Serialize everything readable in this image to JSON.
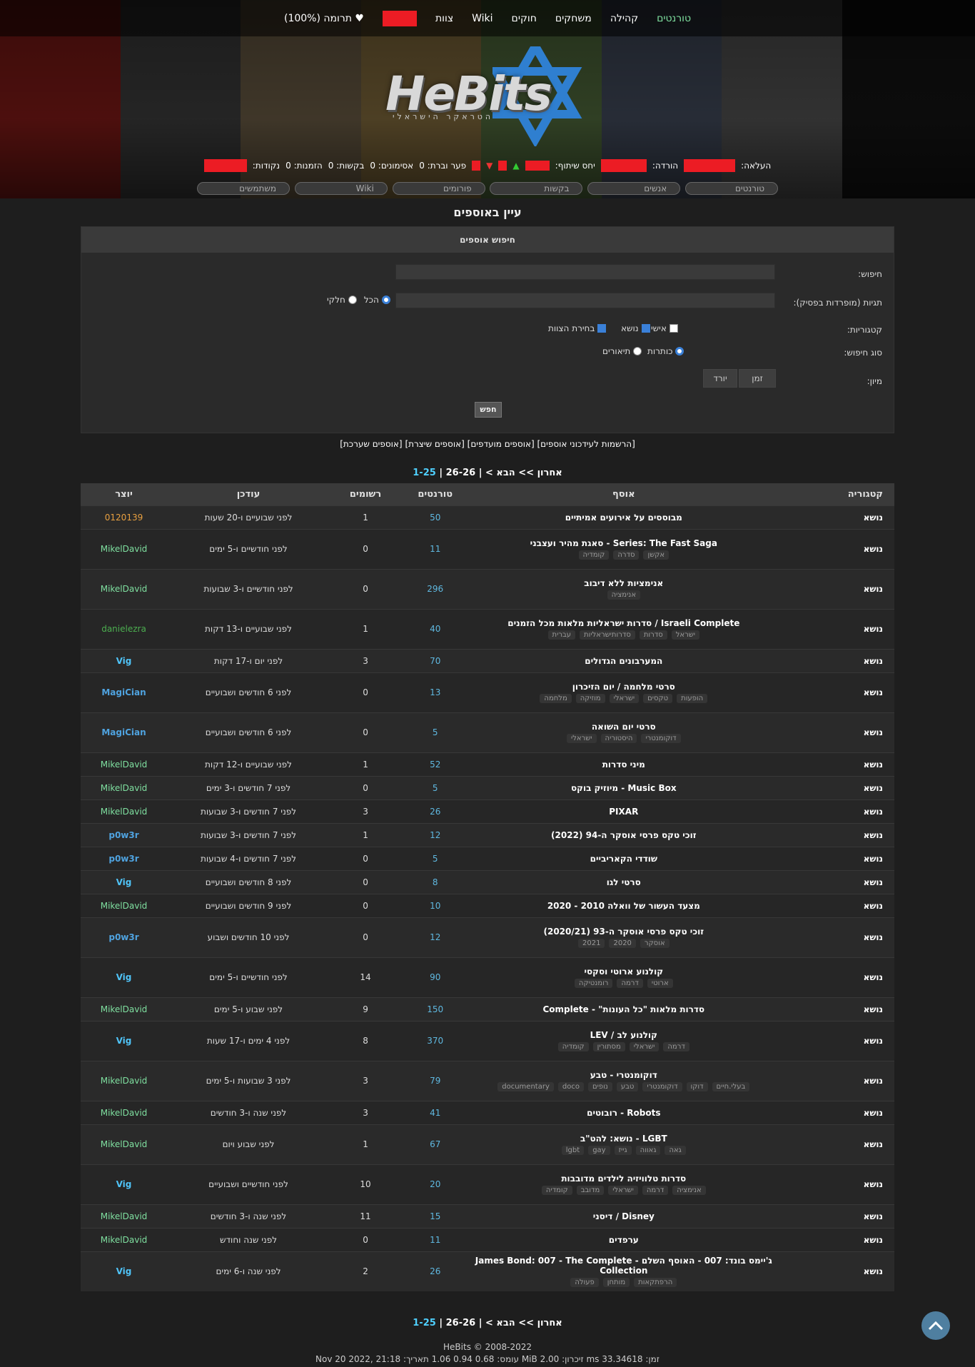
{
  "colors": {
    "accent": "#4fd0ff",
    "active_link": "#7fe0a0",
    "redaction": "#ec1c24"
  },
  "topnav": {
    "items": [
      "טורנטים",
      "קהילה",
      "משחקים",
      "חוקים",
      "Wiki",
      "צוות"
    ],
    "donate": "תרומה (100%)"
  },
  "logo": {
    "text": "HeBits",
    "sub": "הטראקר הישראלי"
  },
  "stats": {
    "upload": "העלאה:",
    "download": "הורדה:",
    "ratio": "יחס שיתוף:",
    "membership": "פער וברת: 0",
    "bookmarks": "אסימונים: 0",
    "requests": "בקשות: 0",
    "invites": "הזמנות: 0",
    "points": "נקודות:"
  },
  "subnav": [
    "טורנטים",
    "אנשים",
    "בקשות",
    "פורומים",
    "Wiki",
    "משתמשים"
  ],
  "page_title": "עיין באוספים",
  "search_panel": {
    "header": "חיפוש אוספים",
    "search_label": "חיפוש:",
    "tags_label": "תגיות (מופרדות בפסיק):",
    "tags_partial": "חלקי",
    "tags_all": "הכל",
    "categories_label": "קטגוריות:",
    "cat_personal": "אישי",
    "cat_topic": "נושא",
    "cat_staff": "בחירת הצוות",
    "search_type_label": "סוג חיפוש:",
    "type_titles": "כותרות",
    "type_desc": "תיאורים",
    "sort_label": "מיון:",
    "sort_time": "זמן",
    "sort_desc": "יורד",
    "search_btn": "חפש"
  },
  "links": [
    "[הרשמות לעידכוני אוספים]",
    "[אוספים מועדפים]",
    "[אוספים שיצרת]",
    "[אוספים שערכת]"
  ],
  "pager": {
    "current": "1-25",
    "next_range": "26-26",
    "next": "הבא >",
    "last": "אחרון >>",
    "sep": " | "
  },
  "table": {
    "headers": [
      "קטגוריה",
      "אוסף",
      "טורנטים",
      "רשומים",
      "עודכן",
      "יוצר"
    ],
    "rows": [
      {
        "cat": "נושא",
        "name": "מבוססים על אירועים אמיתיים",
        "tags": [],
        "torrents": "50",
        "subs": "1",
        "updated": "לפני שבועיים ו-20 שעות",
        "user": "0120139",
        "ucolor": "#e8a040",
        "ubold": false
      },
      {
        "cat": "נושא",
        "name": "Series: The Fast Saga - סאגת מהיר ועצבני",
        "tags": [
          "אקשן",
          "סדרה",
          "קומדיה"
        ],
        "torrents": "11",
        "subs": "0",
        "updated": "לפני חודשיים ו-5 ימים",
        "user": "MikelDavid",
        "ucolor": "#7fe0a0",
        "ubold": false
      },
      {
        "cat": "נושא",
        "name": "אנימציות ללא דיבוב",
        "tags": [
          "אנימציה"
        ],
        "torrents": "296",
        "subs": "0",
        "updated": "לפני חודשיים ו-3 שבועות",
        "user": "MikelDavid",
        "ucolor": "#7fe0a0",
        "ubold": false
      },
      {
        "cat": "נושא",
        "name": "Israeli Complete / סדרות ישראליות מלאות מכל הזמנים",
        "tags": [
          "ישראל",
          "סדרות",
          "סדרותישראליות",
          "עברית"
        ],
        "torrents": "40",
        "subs": "1",
        "updated": "לפני שבועיים ו-13 דקות",
        "user": "danielezra",
        "ucolor": "#4caf50",
        "ubold": false
      },
      {
        "cat": "נושא",
        "name": "המערבונים הגדולים",
        "tags": [],
        "torrents": "70",
        "subs": "3",
        "updated": "לפני יום ו-17 דקות",
        "user": "Vig",
        "ucolor": "#4fc3f7",
        "ubold": true
      },
      {
        "cat": "נושא",
        "name": "סרטי מלחמה / יום הזיכרון",
        "tags": [
          "הופעות",
          "טקסים",
          "ישראלי",
          "מוזיקה",
          "מלחמה"
        ],
        "torrents": "13",
        "subs": "0",
        "updated": "לפני 6 חודשים ושבועיים",
        "user": "MagiCian",
        "ucolor": "#4fa3e0",
        "ubold": true
      },
      {
        "cat": "נושא",
        "name": "סרטי יום השואה",
        "tags": [
          "דוקומנטרי",
          "היסטוריה",
          "ישראלי"
        ],
        "torrents": "5",
        "subs": "0",
        "updated": "לפני 6 חודשים ושבועיים",
        "user": "MagiCian",
        "ucolor": "#4fa3e0",
        "ubold": true
      },
      {
        "cat": "נושא",
        "name": "מיני סדרות",
        "tags": [],
        "torrents": "52",
        "subs": "1",
        "updated": "לפני שבועיים ו-12 דקות",
        "user": "MikelDavid",
        "ucolor": "#7fe0a0",
        "ubold": false
      },
      {
        "cat": "נושא",
        "name": "Music Box - מיוזיק בוקס",
        "tags": [],
        "torrents": "5",
        "subs": "0",
        "updated": "לפני 7 חודשים ו-3 ימים",
        "user": "MikelDavid",
        "ucolor": "#7fe0a0",
        "ubold": false
      },
      {
        "cat": "נושא",
        "name": "PIXAR",
        "tags": [],
        "torrents": "26",
        "subs": "3",
        "updated": "לפני 7 חודשים ו-3 שבועות",
        "user": "MikelDavid",
        "ucolor": "#7fe0a0",
        "ubold": false
      },
      {
        "cat": "נושא",
        "name": "זוכי טקס פרסי אוסקר ה-94 (2022)",
        "tags": [],
        "torrents": "12",
        "subs": "1",
        "updated": "לפני 7 חודשים ו-3 שבועות",
        "user": "p0w3r",
        "ucolor": "#4fa3e0",
        "ubold": true
      },
      {
        "cat": "נושא",
        "name": "שודדי הקאריביים",
        "tags": [],
        "torrents": "5",
        "subs": "0",
        "updated": "לפני 7 חודשים ו-4 שבועות",
        "user": "p0w3r",
        "ucolor": "#4fa3e0",
        "ubold": true
      },
      {
        "cat": "נושא",
        "name": "סרטי לגו",
        "tags": [],
        "torrents": "8",
        "subs": "0",
        "updated": "לפני 8 חודשים ושבועיים",
        "user": "Vig",
        "ucolor": "#4fc3f7",
        "ubold": true
      },
      {
        "cat": "נושא",
        "name": "מצעד העשור של וואלה 2010 - 2020",
        "tags": [],
        "torrents": "10",
        "subs": "0",
        "updated": "לפני 9 חודשים ושבועיים",
        "user": "MikelDavid",
        "ucolor": "#7fe0a0",
        "ubold": false
      },
      {
        "cat": "נושא",
        "name": "זוכי טקס פרסי אוסקר ה-93 (2020/21)",
        "tags": [
          "אוסקר",
          "2020",
          "2021"
        ],
        "torrents": "12",
        "subs": "0",
        "updated": "לפני 10 חודשים ושבוע",
        "user": "p0w3r",
        "ucolor": "#4fa3e0",
        "ubold": true
      },
      {
        "cat": "נושא",
        "name": "קולנוע ארוטי וסקסי",
        "tags": [
          "ארוטי",
          "דרמה",
          "רומנטיקה"
        ],
        "torrents": "90",
        "subs": "14",
        "updated": "לפני חודשיים ו-5 ימים",
        "user": "Vig",
        "ucolor": "#4fc3f7",
        "ubold": true
      },
      {
        "cat": "נושא",
        "name": "סדרות מלאות \"כל העונות\" - Complete",
        "tags": [],
        "torrents": "150",
        "subs": "9",
        "updated": "לפני שבוע ו-5 ימים",
        "user": "MikelDavid",
        "ucolor": "#7fe0a0",
        "ubold": false
      },
      {
        "cat": "נושא",
        "name": "קולנוע לב / LEV",
        "tags": [
          "דרמה",
          "ישראלי",
          "מסתורין",
          "קומדיה"
        ],
        "torrents": "370",
        "subs": "8",
        "updated": "לפני 4 ימים ו-17 שעות",
        "user": "Vig",
        "ucolor": "#4fc3f7",
        "ubold": true
      },
      {
        "cat": "נושא",
        "name": "דוקומנטרי - טבע",
        "tags": [
          "בעלי.חיים",
          "דוקו",
          "דוקומנטרי",
          "טבע",
          "נופים",
          "doco",
          "documentary"
        ],
        "torrents": "79",
        "subs": "3",
        "updated": "לפני 3 שבועות ו-5 ימים",
        "user": "MikelDavid",
        "ucolor": "#7fe0a0",
        "ubold": false
      },
      {
        "cat": "נושא",
        "name": "Robots - רובוטים",
        "tags": [],
        "torrents": "41",
        "subs": "3",
        "updated": "לפני שנה ו-3 חודשים",
        "user": "MikelDavid",
        "ucolor": "#7fe0a0",
        "ubold": false
      },
      {
        "cat": "נושא",
        "name": "LGBT - נושא: להט\"ב",
        "tags": [
          "גאה",
          "גאווה",
          "גייז",
          "gay",
          "lgbt"
        ],
        "torrents": "67",
        "subs": "1",
        "updated": "לפני שבוע ויום",
        "user": "MikelDavid",
        "ucolor": "#7fe0a0",
        "ubold": false
      },
      {
        "cat": "נושא",
        "name": "סדרות טלוויזיה לילדים מדובבות",
        "tags": [
          "אנימציה",
          "דרמה",
          "ישראלי",
          "מדובב",
          "קומדיה"
        ],
        "torrents": "20",
        "subs": "10",
        "updated": "לפני חודשיים ושבועיים",
        "user": "Vig",
        "ucolor": "#4fc3f7",
        "ubold": true
      },
      {
        "cat": "נושא",
        "name": "Disney / דיסני",
        "tags": [],
        "torrents": "15",
        "subs": "11",
        "updated": "לפני שנה ו-3 חודשים",
        "user": "MikelDavid",
        "ucolor": "#7fe0a0",
        "ubold": false
      },
      {
        "cat": "נושא",
        "name": "ערפדים",
        "tags": [],
        "torrents": "11",
        "subs": "0",
        "updated": "לפני שנה וחודש",
        "user": "MikelDavid",
        "ucolor": "#7fe0a0",
        "ubold": false
      },
      {
        "cat": "נושא",
        "name": "ג'יימס בונד: 007 - האוסף השלם - James Bond: 007 - The Complete Collection",
        "tags": [
          "הרפתקאות",
          "מותחן",
          "פעולה"
        ],
        "torrents": "26",
        "subs": "2",
        "updated": "לפני שנה ו-6 ימים",
        "user": "Vig",
        "ucolor": "#4fc3f7",
        "ubold": true
      }
    ]
  },
  "footer": {
    "copyright": "HeBits © 2008-2022",
    "perf": "זמן: 33.34618 ms זיכרון: 2.00 MiB עומס: 0.68 0.94 1.06 תאריך: Nov 20 2022, 21:18"
  }
}
